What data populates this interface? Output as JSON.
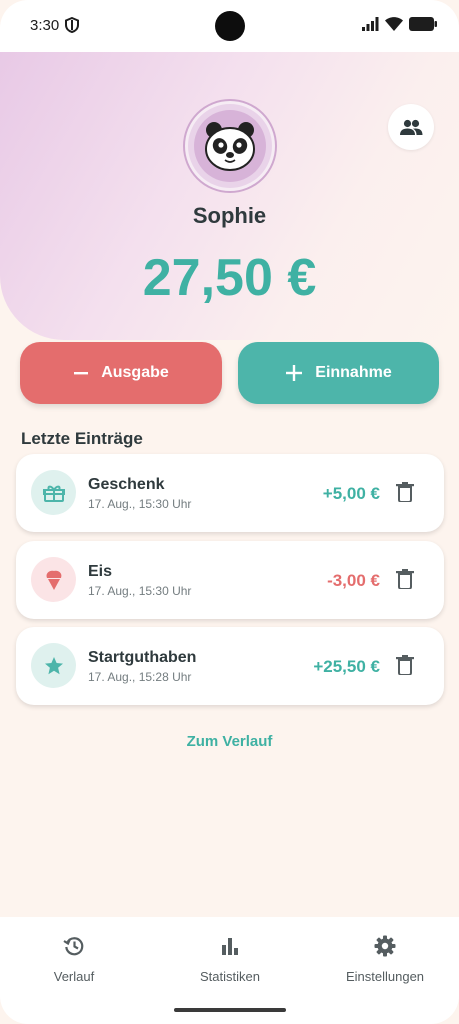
{
  "status_bar": {
    "time": "3:30"
  },
  "header": {
    "user_name": "Sophie",
    "balance": "27,50 €",
    "avatar_icon": "panda-icon",
    "group_icon": "group-icon"
  },
  "actions": {
    "expense_label": "Ausgabe",
    "income_label": "Einnahme"
  },
  "recent": {
    "title": "Letzte Einträge",
    "entries": [
      {
        "title": "Geschenk",
        "date": "17. Aug., 15:30 Uhr",
        "amount": "+5,00 €",
        "type": "income",
        "icon": "gift-icon"
      },
      {
        "title": "Eis",
        "date": "17. Aug., 15:30 Uhr",
        "amount": "-3,00 €",
        "type": "expense",
        "icon": "ice-cream-icon"
      },
      {
        "title": "Startguthaben",
        "date": "17. Aug., 15:28 Uhr",
        "amount": "+25,50 €",
        "type": "income",
        "icon": "star-icon"
      }
    ],
    "history_link": "Zum Verlauf"
  },
  "nav": {
    "items": [
      {
        "label": "Verlauf",
        "icon": "history-icon"
      },
      {
        "label": "Statistiken",
        "icon": "bar-chart-icon"
      },
      {
        "label": "Einstellungen",
        "icon": "gear-icon"
      }
    ]
  },
  "colors": {
    "income": "#3fb1a3",
    "expense": "#e46d6d",
    "background": "#fdf4ee"
  }
}
